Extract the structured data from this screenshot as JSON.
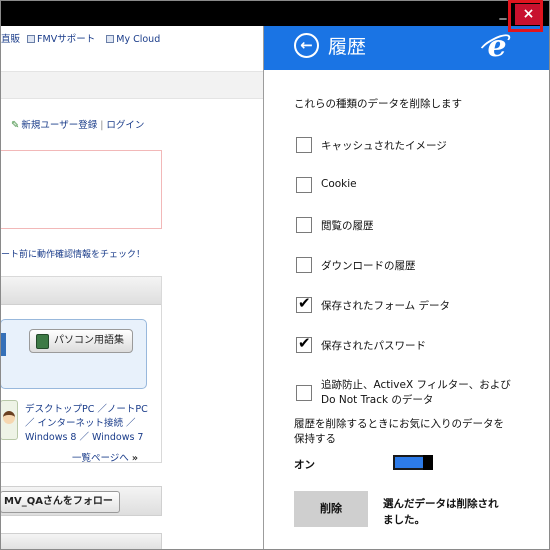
{
  "window": {
    "minimize_glyph": "_",
    "close_glyph": "×",
    "accent_close": "#c8102e",
    "highlight_color": "#e0141e"
  },
  "webpage": {
    "top_links": [
      "直販",
      "FMVサポート",
      "My Cloud"
    ],
    "register_link": "新規ユーザー登録",
    "separator": "|",
    "login_link": "ログイン",
    "check_note": "ート前に動作確認情報をチェック！",
    "glossary_button": "パソコン用語集",
    "pc_links": {
      "line1": "デスクトップPC ／ノートPC",
      "line2": "／ インターネット接続 ／",
      "line3": "Windows 8 ／ Windows 7"
    },
    "list_page_link": "一覧ページへ",
    "list_page_arrows": "»",
    "follow_button": "MV_QAさんをフォロー"
  },
  "flyout": {
    "header_color": "#1a74e4",
    "back_glyph": "←",
    "title": "履歴",
    "brand_icon": "ie-icon",
    "intro": "これらの種類のデータを削除します",
    "options": [
      {
        "label": "キャッシュされたイメージ",
        "checked": false
      },
      {
        "label": "Cookie",
        "checked": false
      },
      {
        "label": "閲覧の履歴",
        "checked": false
      },
      {
        "label": "ダウンロードの履歴",
        "checked": false
      },
      {
        "label": "保存されたフォーム データ",
        "checked": true
      },
      {
        "label": "保存されたパスワード",
        "checked": true
      },
      {
        "label": "追跡防止、ActiveX フィルター、および Do Not Track のデータ",
        "checked": false
      }
    ],
    "check_glyph": "✔",
    "favorites_text": "履歴を削除するときにお気に入りのデータを保持する",
    "toggle_state": "オン",
    "toggle_on": true,
    "delete_button": "削除",
    "status_message": "選んだデータは削除されました。"
  }
}
